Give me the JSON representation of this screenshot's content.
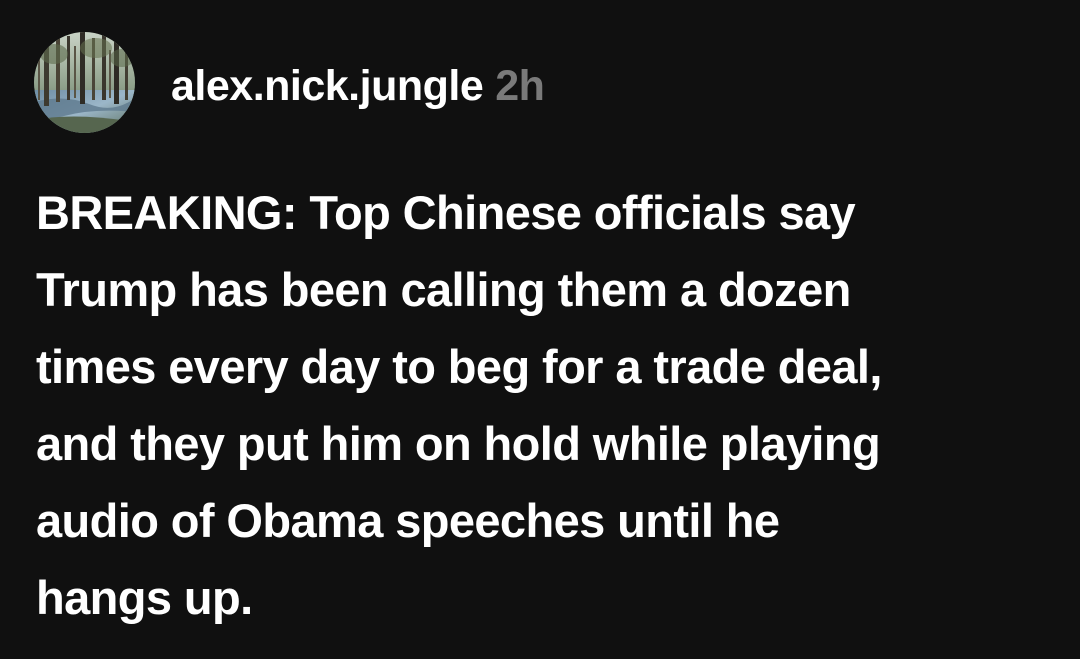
{
  "post": {
    "author": {
      "username": "alex.nick.jungle",
      "avatar_icon": "forest-avatar"
    },
    "timestamp": "2h",
    "text": "BREAKING: Top Chinese officials say\nTrump has been calling them a dozen\ntimes every day to beg for a trade deal,\nand they put him on hold while playing\naudio of Obama speeches until he\nhangs up."
  },
  "colors": {
    "background": "#101010",
    "text": "#ffffff",
    "muted": "#7a7a7a"
  }
}
